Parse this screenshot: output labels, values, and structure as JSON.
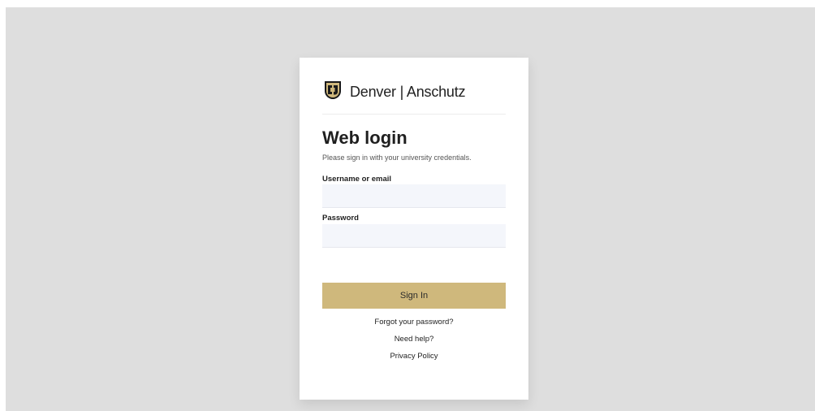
{
  "brand": {
    "name": "Denver | Anschutz",
    "logo_colors": {
      "gold": "#cfb87c",
      "black": "#1a1a1a"
    }
  },
  "login": {
    "title": "Web login",
    "subtitle": "Please sign in with your university credentials.",
    "username_label": "Username or email",
    "username_value": "",
    "password_label": "Password",
    "password_value": "",
    "signin_label": "Sign In"
  },
  "links": {
    "forgot": "Forgot your password?",
    "help": "Need help?",
    "privacy": "Privacy Policy"
  },
  "colors": {
    "accent": "#cfb87c",
    "backdrop": "#dedede",
    "field_bg": "#f4f6fb"
  }
}
